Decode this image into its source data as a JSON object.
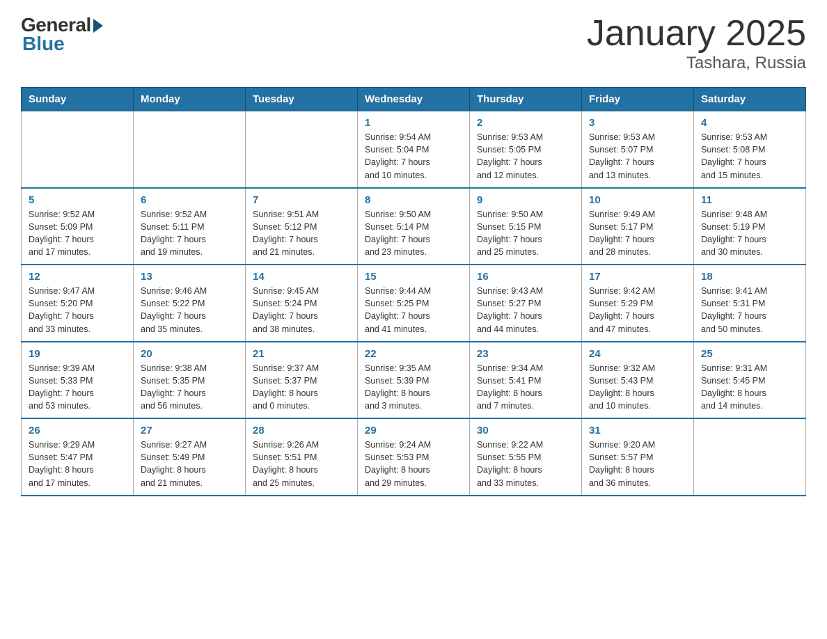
{
  "header": {
    "logo_general": "General",
    "logo_blue": "Blue",
    "title": "January 2025",
    "subtitle": "Tashara, Russia"
  },
  "weekdays": [
    "Sunday",
    "Monday",
    "Tuesday",
    "Wednesday",
    "Thursday",
    "Friday",
    "Saturday"
  ],
  "weeks": [
    [
      {
        "day": "",
        "info": ""
      },
      {
        "day": "",
        "info": ""
      },
      {
        "day": "",
        "info": ""
      },
      {
        "day": "1",
        "info": "Sunrise: 9:54 AM\nSunset: 5:04 PM\nDaylight: 7 hours\nand 10 minutes."
      },
      {
        "day": "2",
        "info": "Sunrise: 9:53 AM\nSunset: 5:05 PM\nDaylight: 7 hours\nand 12 minutes."
      },
      {
        "day": "3",
        "info": "Sunrise: 9:53 AM\nSunset: 5:07 PM\nDaylight: 7 hours\nand 13 minutes."
      },
      {
        "day": "4",
        "info": "Sunrise: 9:53 AM\nSunset: 5:08 PM\nDaylight: 7 hours\nand 15 minutes."
      }
    ],
    [
      {
        "day": "5",
        "info": "Sunrise: 9:52 AM\nSunset: 5:09 PM\nDaylight: 7 hours\nand 17 minutes."
      },
      {
        "day": "6",
        "info": "Sunrise: 9:52 AM\nSunset: 5:11 PM\nDaylight: 7 hours\nand 19 minutes."
      },
      {
        "day": "7",
        "info": "Sunrise: 9:51 AM\nSunset: 5:12 PM\nDaylight: 7 hours\nand 21 minutes."
      },
      {
        "day": "8",
        "info": "Sunrise: 9:50 AM\nSunset: 5:14 PM\nDaylight: 7 hours\nand 23 minutes."
      },
      {
        "day": "9",
        "info": "Sunrise: 9:50 AM\nSunset: 5:15 PM\nDaylight: 7 hours\nand 25 minutes."
      },
      {
        "day": "10",
        "info": "Sunrise: 9:49 AM\nSunset: 5:17 PM\nDaylight: 7 hours\nand 28 minutes."
      },
      {
        "day": "11",
        "info": "Sunrise: 9:48 AM\nSunset: 5:19 PM\nDaylight: 7 hours\nand 30 minutes."
      }
    ],
    [
      {
        "day": "12",
        "info": "Sunrise: 9:47 AM\nSunset: 5:20 PM\nDaylight: 7 hours\nand 33 minutes."
      },
      {
        "day": "13",
        "info": "Sunrise: 9:46 AM\nSunset: 5:22 PM\nDaylight: 7 hours\nand 35 minutes."
      },
      {
        "day": "14",
        "info": "Sunrise: 9:45 AM\nSunset: 5:24 PM\nDaylight: 7 hours\nand 38 minutes."
      },
      {
        "day": "15",
        "info": "Sunrise: 9:44 AM\nSunset: 5:25 PM\nDaylight: 7 hours\nand 41 minutes."
      },
      {
        "day": "16",
        "info": "Sunrise: 9:43 AM\nSunset: 5:27 PM\nDaylight: 7 hours\nand 44 minutes."
      },
      {
        "day": "17",
        "info": "Sunrise: 9:42 AM\nSunset: 5:29 PM\nDaylight: 7 hours\nand 47 minutes."
      },
      {
        "day": "18",
        "info": "Sunrise: 9:41 AM\nSunset: 5:31 PM\nDaylight: 7 hours\nand 50 minutes."
      }
    ],
    [
      {
        "day": "19",
        "info": "Sunrise: 9:39 AM\nSunset: 5:33 PM\nDaylight: 7 hours\nand 53 minutes."
      },
      {
        "day": "20",
        "info": "Sunrise: 9:38 AM\nSunset: 5:35 PM\nDaylight: 7 hours\nand 56 minutes."
      },
      {
        "day": "21",
        "info": "Sunrise: 9:37 AM\nSunset: 5:37 PM\nDaylight: 8 hours\nand 0 minutes."
      },
      {
        "day": "22",
        "info": "Sunrise: 9:35 AM\nSunset: 5:39 PM\nDaylight: 8 hours\nand 3 minutes."
      },
      {
        "day": "23",
        "info": "Sunrise: 9:34 AM\nSunset: 5:41 PM\nDaylight: 8 hours\nand 7 minutes."
      },
      {
        "day": "24",
        "info": "Sunrise: 9:32 AM\nSunset: 5:43 PM\nDaylight: 8 hours\nand 10 minutes."
      },
      {
        "day": "25",
        "info": "Sunrise: 9:31 AM\nSunset: 5:45 PM\nDaylight: 8 hours\nand 14 minutes."
      }
    ],
    [
      {
        "day": "26",
        "info": "Sunrise: 9:29 AM\nSunset: 5:47 PM\nDaylight: 8 hours\nand 17 minutes."
      },
      {
        "day": "27",
        "info": "Sunrise: 9:27 AM\nSunset: 5:49 PM\nDaylight: 8 hours\nand 21 minutes."
      },
      {
        "day": "28",
        "info": "Sunrise: 9:26 AM\nSunset: 5:51 PM\nDaylight: 8 hours\nand 25 minutes."
      },
      {
        "day": "29",
        "info": "Sunrise: 9:24 AM\nSunset: 5:53 PM\nDaylight: 8 hours\nand 29 minutes."
      },
      {
        "day": "30",
        "info": "Sunrise: 9:22 AM\nSunset: 5:55 PM\nDaylight: 8 hours\nand 33 minutes."
      },
      {
        "day": "31",
        "info": "Sunrise: 9:20 AM\nSunset: 5:57 PM\nDaylight: 8 hours\nand 36 minutes."
      },
      {
        "day": "",
        "info": ""
      }
    ]
  ]
}
